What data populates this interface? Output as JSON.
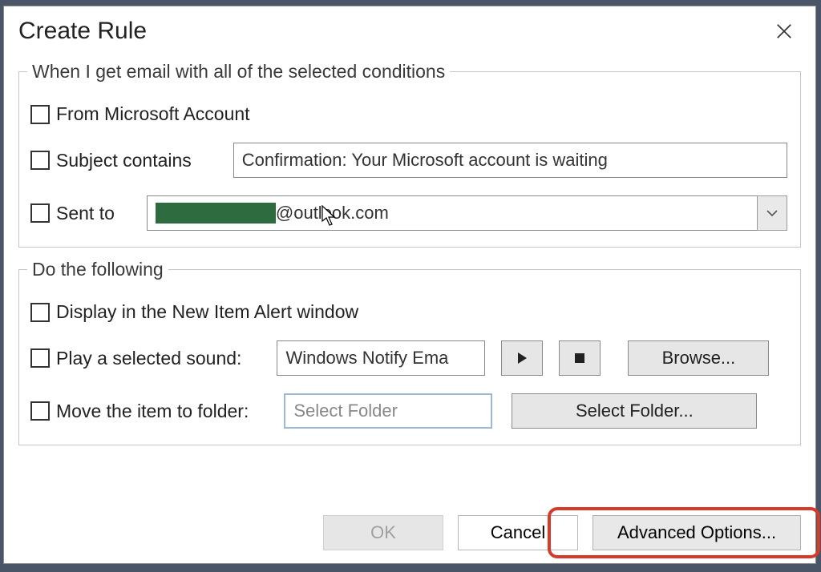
{
  "dialog": {
    "title": "Create Rule"
  },
  "conditions": {
    "legend": "When I get email with all of the selected conditions",
    "from_label": "From Microsoft Account",
    "subject_label": "Subject contains",
    "subject_value": "Confirmation: Your Microsoft account is waiting",
    "sentto_label": "Sent to",
    "sentto_value_suffix": "@outlook.com"
  },
  "actions": {
    "legend": "Do the following",
    "display_alert_label": "Display in the New Item Alert window",
    "play_sound_label": "Play a selected sound:",
    "sound_value": "Windows Notify Ema",
    "browse_label": "Browse...",
    "move_label": "Move the item to folder:",
    "folder_placeholder": "Select Folder",
    "select_folder_label": "Select Folder..."
  },
  "buttons": {
    "ok": "OK",
    "cancel": "Cancel",
    "advanced": "Advanced Options..."
  }
}
